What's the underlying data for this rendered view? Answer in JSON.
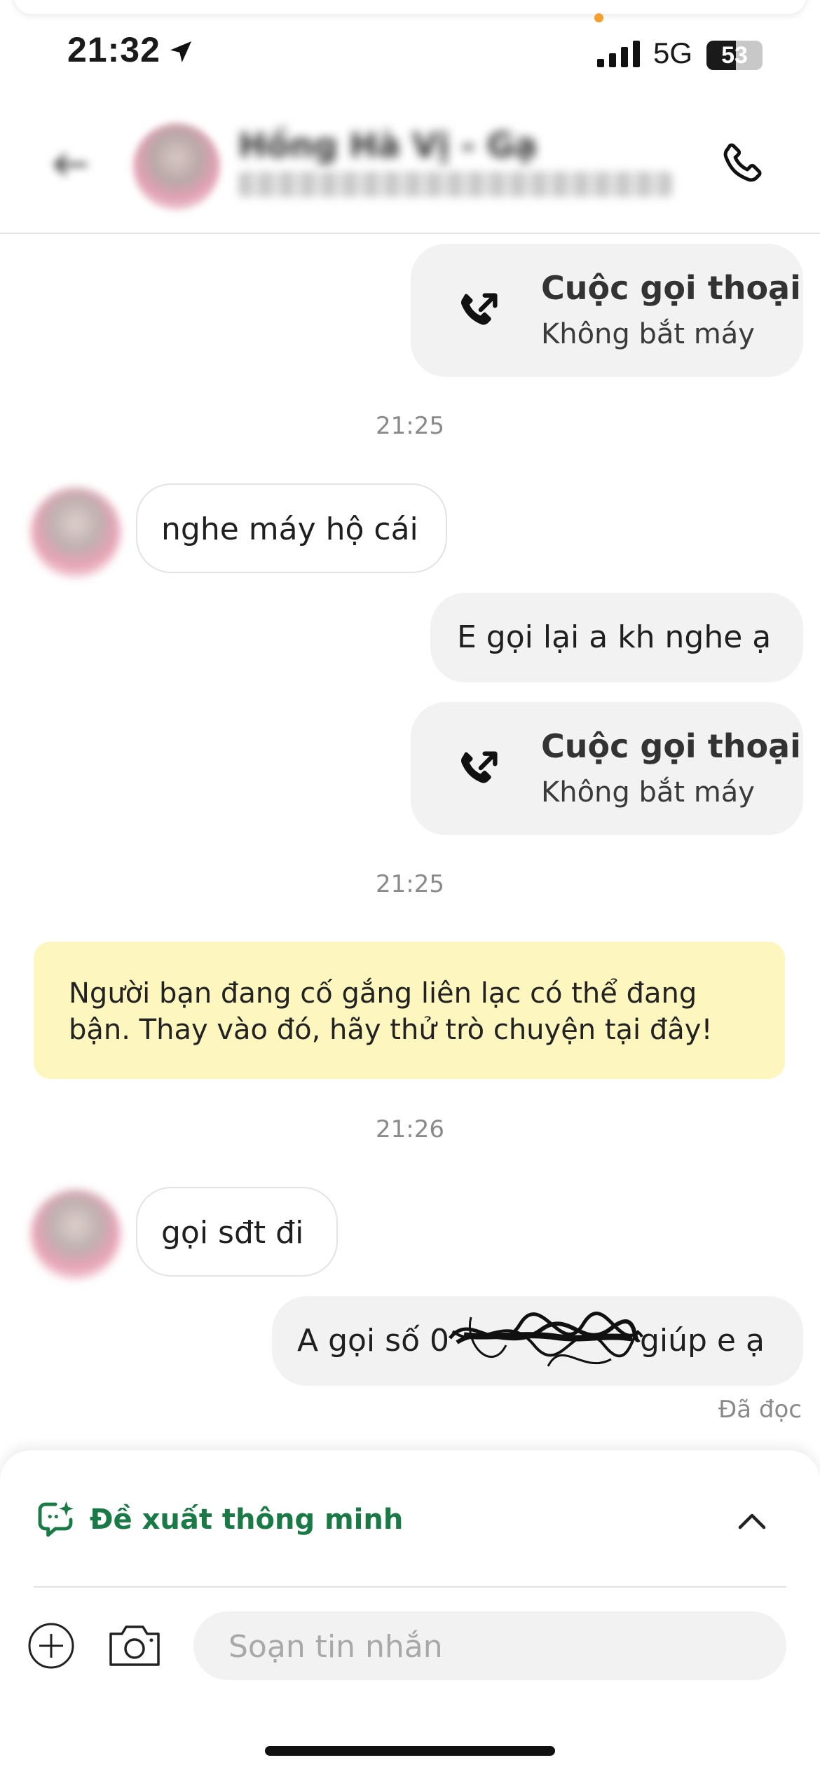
{
  "status_bar": {
    "time": "21:32",
    "network": "5G",
    "battery": "53",
    "battery_level": 0.53
  },
  "header": {
    "contact_name": "Hồng Hà Vị - Gạ"
  },
  "messages": {
    "call1": {
      "title": "Cuộc gọi thoại",
      "subtitle": "Không bắt máy"
    },
    "ts1": "21:25",
    "in1": "nghe máy hộ cái",
    "out1": "E gọi lại a kh nghe ạ",
    "call2": {
      "title": "Cuộc gọi thoại",
      "subtitle": "Không bắt máy"
    },
    "ts2": "21:25",
    "notice": "Người bạn đang cố gắng liên lạc có thể đang bận. Thay vào đó, hãy thử trò chuyện tại đây!",
    "ts3": "21:26",
    "in2": "gọi sđt đi",
    "out2_before": "A gọi số 0",
    "out2_after": " giúp e ạ",
    "read_status": "Đã đọc"
  },
  "composer": {
    "smart_suggest_label": "Đề xuất thông minh",
    "placeholder": "Soạn tin nhắn"
  },
  "colors": {
    "accent_green": "#1a7a46",
    "notice_bg": "#fdf7bf",
    "bubble_bg": "#f2f2f2"
  },
  "icons": [
    "location-arrow-icon",
    "signal-icon",
    "back-arrow-icon",
    "phone-icon",
    "outgoing-call-icon",
    "sparkle-chat-icon",
    "chevron-up-icon",
    "plus-circle-icon",
    "camera-icon"
  ]
}
